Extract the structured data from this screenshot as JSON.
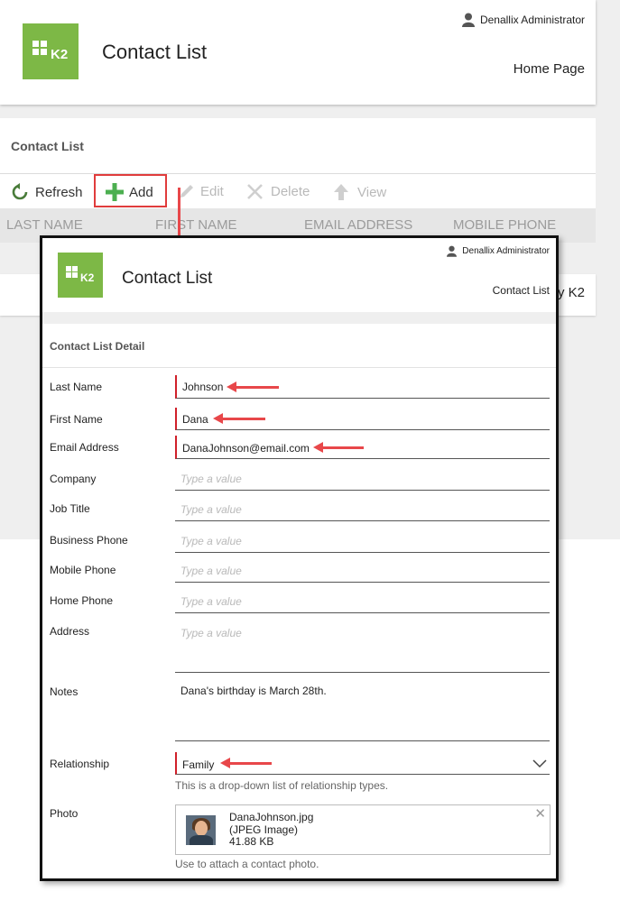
{
  "background": {
    "user": "Denallix Administrator",
    "app_title": "Contact List",
    "home_link": "Home Page",
    "panel_title": "Contact List",
    "toolbar": {
      "refresh": "Refresh",
      "add": "Add",
      "edit": "Edit",
      "delete": "Delete",
      "view": "View"
    },
    "columns": [
      "LAST NAME",
      "FIRST NAME",
      "EMAIL ADDRESS",
      "MOBILE PHONE"
    ],
    "footer_text": "y K2"
  },
  "logo": {
    "text": "K2"
  },
  "modal": {
    "user": "Denallix Administrator",
    "title": "Contact List",
    "home_link": "Contact List",
    "section_title": "Contact List Detail",
    "fields": {
      "last_name": {
        "label": "Last Name",
        "value": "Johnson"
      },
      "first_name": {
        "label": "First Name",
        "value": "Dana"
      },
      "email": {
        "label": "Email Address",
        "value": "DanaJohnson@email.com"
      },
      "company": {
        "label": "Company",
        "placeholder": "Type a value"
      },
      "job_title": {
        "label": "Job Title",
        "placeholder": "Type a value"
      },
      "business_phone": {
        "label": "Business Phone",
        "placeholder": "Type a value"
      },
      "mobile_phone": {
        "label": "Mobile Phone",
        "placeholder": "Type a value"
      },
      "home_phone": {
        "label": "Home Phone",
        "placeholder": "Type a value"
      },
      "address": {
        "label": "Address",
        "placeholder": "Type a value"
      },
      "notes": {
        "label": "Notes",
        "value": "Dana's birthday is March 28th."
      },
      "relationship": {
        "label": "Relationship",
        "value": "Family",
        "hint": "This is a drop-down list of relationship types."
      },
      "photo": {
        "label": "Photo",
        "file_name": "DanaJohnson.jpg",
        "file_type": "(JPEG Image)",
        "file_size": "41.88 KB",
        "hint": "Use to attach a contact photo."
      }
    }
  },
  "colors": {
    "k2_green": "#7db846",
    "annotation_red": "#e8474a",
    "required_marker": "#d0202a",
    "add_icon_green": "#4caf50"
  },
  "icons": [
    "person-icon",
    "refresh-icon",
    "plus-icon",
    "pencil-icon",
    "x-icon",
    "up-arrow-icon",
    "chevron-down-icon",
    "close-icon"
  ]
}
